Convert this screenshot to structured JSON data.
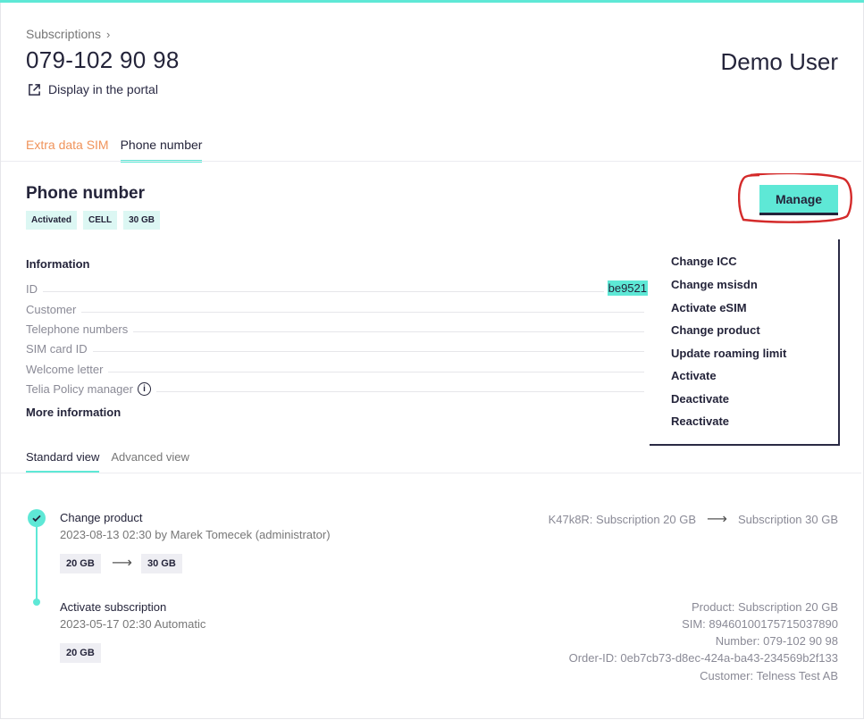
{
  "breadcrumb": {
    "label": "Subscriptions"
  },
  "header": {
    "title": "079-102 90 98",
    "user": "Demo User",
    "portal_link": "Display in the portal"
  },
  "tabs": [
    {
      "label": "Extra data SIM"
    },
    {
      "label": "Phone number"
    }
  ],
  "section": {
    "title": "Phone number",
    "badges": [
      "Activated",
      "CELL",
      "30 GB"
    ]
  },
  "manage": {
    "label": "Manage",
    "menu": [
      "Change ICC",
      "Change msisdn",
      "Activate eSIM",
      "Change product",
      "Update roaming limit",
      "Activate",
      "Deactivate",
      "Reactivate"
    ]
  },
  "info": {
    "heading": "Information",
    "rows": [
      {
        "label": "ID",
        "value": "be9521"
      },
      {
        "label": "Customer",
        "value": ""
      },
      {
        "label": "Telephone numbers",
        "value": ""
      },
      {
        "label": "SIM card ID",
        "value": ""
      },
      {
        "label": "Welcome letter",
        "value": ""
      },
      {
        "label": "Telia Policy manager",
        "value": ""
      }
    ],
    "more": "More information"
  },
  "views": [
    {
      "label": "Standard view"
    },
    {
      "label": "Advanced view"
    }
  ],
  "events": [
    {
      "title": "Change product",
      "sub": "2023-08-13 02:30 by Marek Tomecek (administrator)",
      "from_chip": "20 GB",
      "to_chip": "30 GB",
      "detail_from": "K47k8R: Subscription 20 GB",
      "detail_to": "Subscription 30 GB"
    },
    {
      "title": "Activate subscription",
      "sub": "2023-05-17 02:30 Automatic",
      "chip": "20 GB",
      "details": [
        "Product: Subscription 20 GB",
        "SIM: 89460100175715037890",
        "Number: 079-102 90 98",
        "Order-ID: 0eb7cb73-d8ec-424a-ba43-234569b2f133",
        "Customer: Telness Test AB"
      ]
    }
  ],
  "colors": {
    "accent": "#5ee8d6",
    "muted_tab": "#f0935a",
    "annotation": "#d42a2a"
  }
}
